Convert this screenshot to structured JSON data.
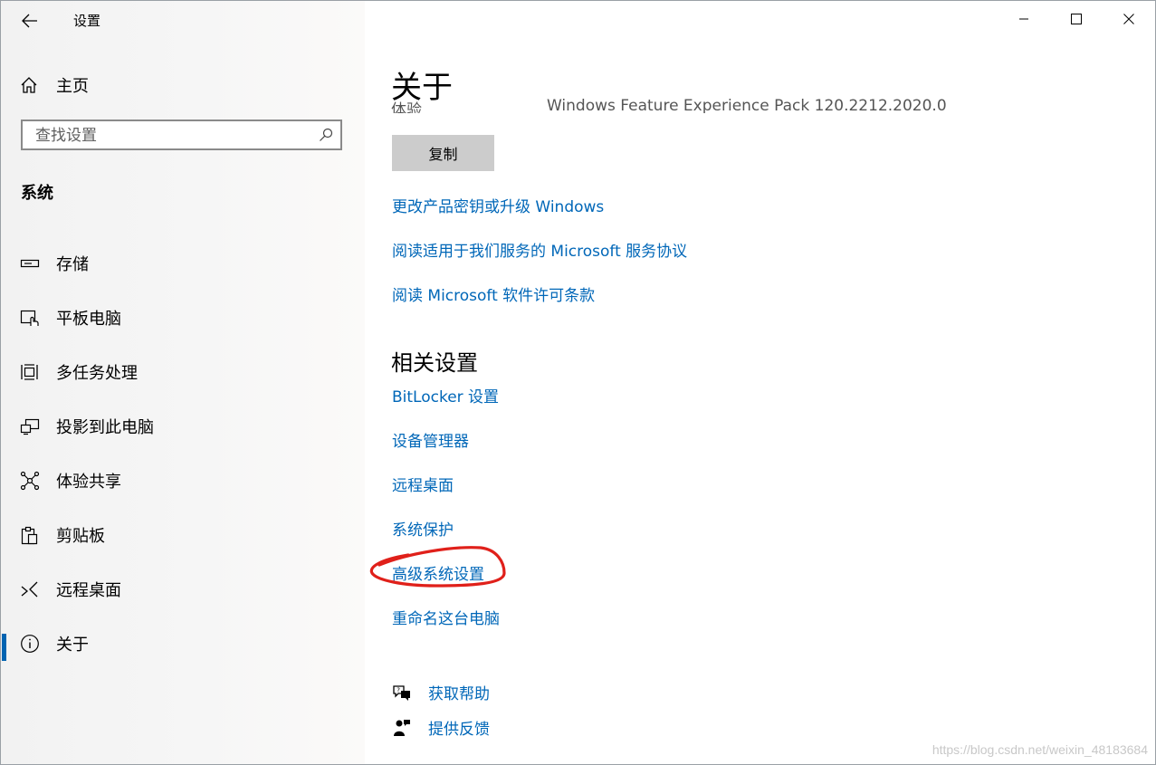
{
  "app": {
    "title": "设置"
  },
  "sidebar": {
    "home_label": "主页",
    "search_placeholder": "查找设置",
    "section_title": "系统",
    "items": [
      {
        "label": "存储",
        "icon": "storage-icon"
      },
      {
        "label": "平板电脑",
        "icon": "tablet-icon"
      },
      {
        "label": "多任务处理",
        "icon": "multitasking-icon"
      },
      {
        "label": "投影到此电脑",
        "icon": "project-icon"
      },
      {
        "label": "体验共享",
        "icon": "shared-experiences-icon"
      },
      {
        "label": "剪贴板",
        "icon": "clipboard-icon"
      },
      {
        "label": "远程桌面",
        "icon": "remote-desktop-icon"
      },
      {
        "label": "关于",
        "icon": "info-icon",
        "active": true
      }
    ]
  },
  "main": {
    "page_title": "关于",
    "clipped_row": {
      "label": "体验",
      "value": "Windows Feature Experience Pack 120.2212.2020.0"
    },
    "copy_button": "复制",
    "links": [
      "更改产品密钥或升级 Windows",
      "阅读适用于我们服务的 Microsoft 服务协议",
      "阅读 Microsoft 软件许可条款"
    ],
    "related_title": "相关设置",
    "related_links": [
      "BitLocker 设置",
      "设备管理器",
      "远程桌面",
      "系统保护",
      "高级系统设置",
      "重命名这台电脑"
    ],
    "help": {
      "get_help": "获取帮助",
      "feedback": "提供反馈"
    }
  },
  "annotation": {
    "circled_item": "高级系统设置",
    "color": "#e0201a"
  },
  "watermark": "https://blog.csdn.net/weixin_48183684"
}
